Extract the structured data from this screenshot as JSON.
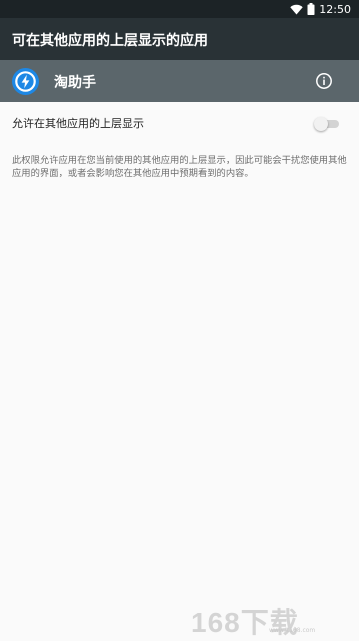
{
  "status_bar": {
    "time": "12:50",
    "icons": [
      "wifi-icon",
      "battery-icon"
    ]
  },
  "app_bar": {
    "title": "可在其他应用的上层显示的应用"
  },
  "app_header": {
    "icon": "lightning-icon",
    "name": "淘助手",
    "info_icon": "info-icon"
  },
  "setting": {
    "label": "允许在其他应用的上层显示",
    "toggle_on": false
  },
  "description": "此权限允许应用在您当前使用的其他应用的上层显示，因此可能会干扰您使用其他应用的界面，或者会影响您在其他应用中预期看到的内容。",
  "watermark": {
    "brand": "168下载",
    "url": "www.it168.com"
  },
  "colors": {
    "status_bar": "#1c2326",
    "app_bar": "#293236",
    "app_header": "#5b666b",
    "app_icon": "#1e88e5",
    "background": "#fafafa"
  }
}
